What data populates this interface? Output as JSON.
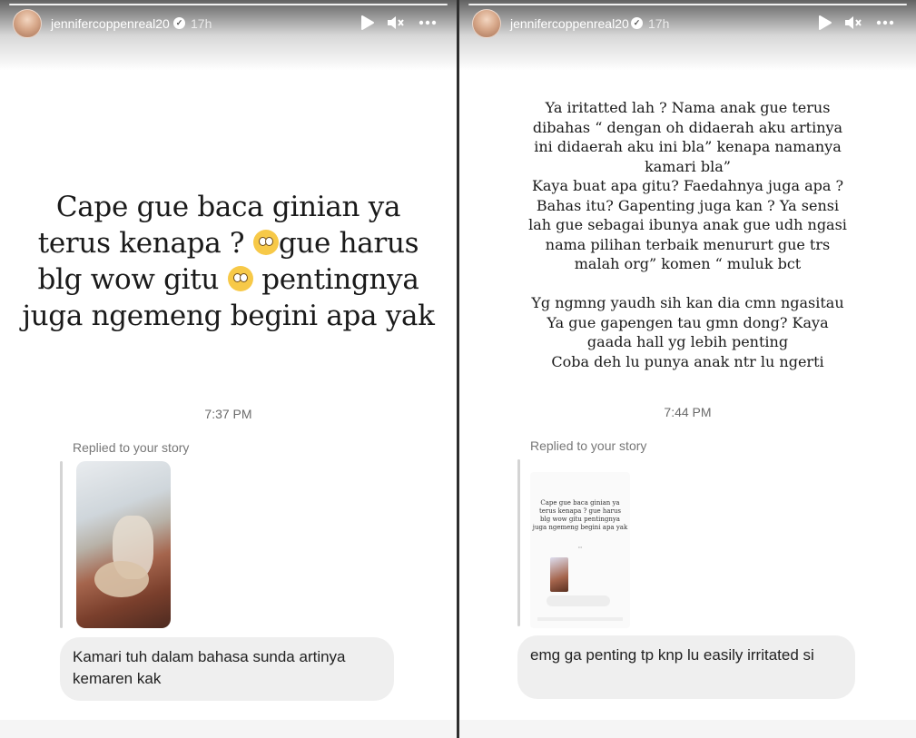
{
  "stories": [
    {
      "header": {
        "username": "jennifercoppenreal20",
        "time_ago": "17h"
      },
      "text_lines": [
        "Cape gue baca ginian ya",
        "terus kenapa ? ",
        "gue harus",
        "blg wow gitu ",
        " pentingnya",
        "juga ngemeng begini apa yak"
      ],
      "message_time": "7:37 PM",
      "replied_label": "Replied to your story",
      "reply_text": "Kamari tuh dalam bahasa sunda artinya kemaren kak"
    },
    {
      "header": {
        "username": "jennifercoppenreal20",
        "time_ago": "17h"
      },
      "text_lines": [
        "Ya iritatted lah ? Nama anak gue terus",
        "dibahas “ dengan oh didaerah aku artinya",
        "ini didaerah aku ini bla” kenapa namanya",
        "kamari bla”",
        "Kaya buat apa gitu? Faedahnya juga apa ?",
        "Bahas itu? Gapenting juga kan ? Ya sensi",
        "lah gue sebagai ibunya anak gue udh ngasi",
        "nama pilihan terbaik menururt gue trs",
        "malah org” komen “ muluk bct",
        "",
        "Yg ngmng yaudh sih kan dia cmn ngasitau",
        "Ya gue gapengen tau gmn dong? Kaya",
        "gaada hall yg lebih penting",
        "Coba deh lu punya anak ntr lu ngerti"
      ],
      "message_time": "7:44 PM",
      "replied_label": "Replied to your story",
      "reply_text": "emg ga penting tp knp lu easily irritated si",
      "mini_screenshot_lines": [
        "Cape gue baca ginian ya",
        "terus kenapa ? gue harus",
        "blg wow gitu pentingnya",
        "juga ngemeng begini apa yak"
      ]
    }
  ],
  "icons": {
    "play": "play-icon",
    "mute": "speaker-muted-icon",
    "more": "more-horizontal-icon",
    "verified": "verified-badge-icon"
  }
}
